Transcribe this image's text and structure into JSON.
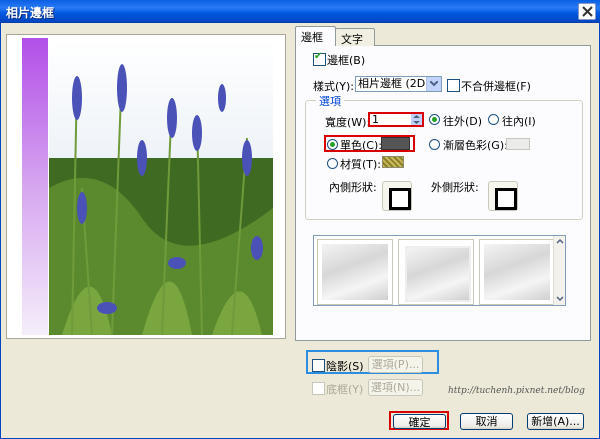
{
  "window": {
    "title": "相片邊框"
  },
  "tabs": [
    {
      "label": "邊框"
    },
    {
      "label": "文字"
    }
  ],
  "border_checkbox": {
    "label": "邊框(B)",
    "checked": true
  },
  "style": {
    "label": "樣式(Y):",
    "value": "相片邊框 (2D)"
  },
  "no_merge": {
    "label": "不合併邊框(F)",
    "checked": false
  },
  "options": {
    "title": "選項",
    "width_label": "寬度(W):",
    "width_value": "1",
    "outside": "往外(D)",
    "inside": "往內(I)",
    "single_color": "單色(C):",
    "gradient": "漸層色彩(G):",
    "texture": "材質(T):",
    "inner_shape": "內側形狀:",
    "outer_shape": "外側形狀:",
    "colors": {
      "single": "#555555"
    }
  },
  "shadow": {
    "label": "陰影(S)",
    "options_button": "選項(P)..."
  },
  "base_frame": {
    "label": "底框(Y)",
    "options_button": "選項(N)..."
  },
  "buttons": {
    "ok": "確定",
    "cancel": "取消",
    "add": "新增(A)..."
  },
  "watermark": "http://tuchenh.pixnet.net/blog"
}
